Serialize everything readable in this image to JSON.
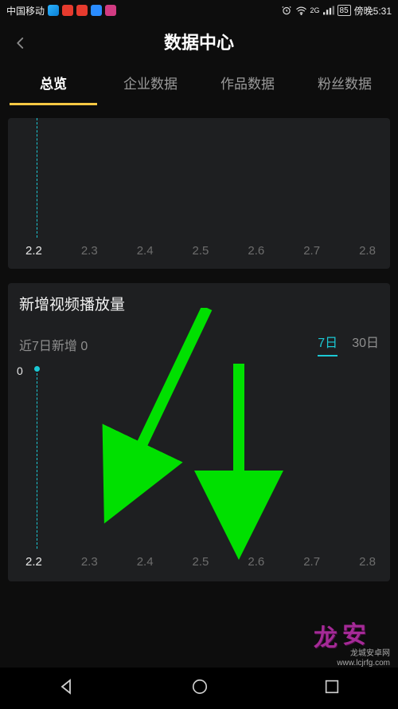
{
  "status": {
    "carrier": "中国移动",
    "network": "2G",
    "battery": "85",
    "time": "傍晚5:31"
  },
  "header": {
    "title": "数据中心"
  },
  "tabs": [
    {
      "label": "总览",
      "active": true
    },
    {
      "label": "企业数据",
      "active": false
    },
    {
      "label": "作品数据",
      "active": false
    },
    {
      "label": "粉丝数据",
      "active": false
    }
  ],
  "cardTopAxis": [
    "2.2",
    "2.3",
    "2.4",
    "2.5",
    "2.6",
    "2.7",
    "2.8"
  ],
  "cardMain": {
    "title": "新增视频播放量",
    "subLabel": "近7日新增 0",
    "periods": [
      {
        "label": "7日",
        "active": true
      },
      {
        "label": "30日",
        "active": false
      }
    ],
    "zero": "0",
    "xaxis": [
      "2.2",
      "2.3",
      "2.4",
      "2.5",
      "2.6",
      "2.7",
      "2.8"
    ]
  },
  "watermark": {
    "site": "龙城安卓网",
    "url": "www.lcjrfg.com"
  },
  "chart_data": [
    {
      "type": "line",
      "categories": [
        "2.2",
        "2.3",
        "2.4",
        "2.5",
        "2.6",
        "2.7",
        "2.8"
      ],
      "values": [
        0,
        0,
        0,
        0,
        0,
        0,
        0
      ],
      "title": "",
      "xlabel": "",
      "ylabel": ""
    },
    {
      "type": "line",
      "title": "新增视频播放量",
      "categories": [
        "2.2",
        "2.3",
        "2.4",
        "2.5",
        "2.6",
        "2.7",
        "2.8"
      ],
      "values": [
        0,
        0,
        0,
        0,
        0,
        0,
        0
      ],
      "xlabel": "",
      "ylabel": "",
      "ylim": [
        0,
        null
      ]
    }
  ]
}
